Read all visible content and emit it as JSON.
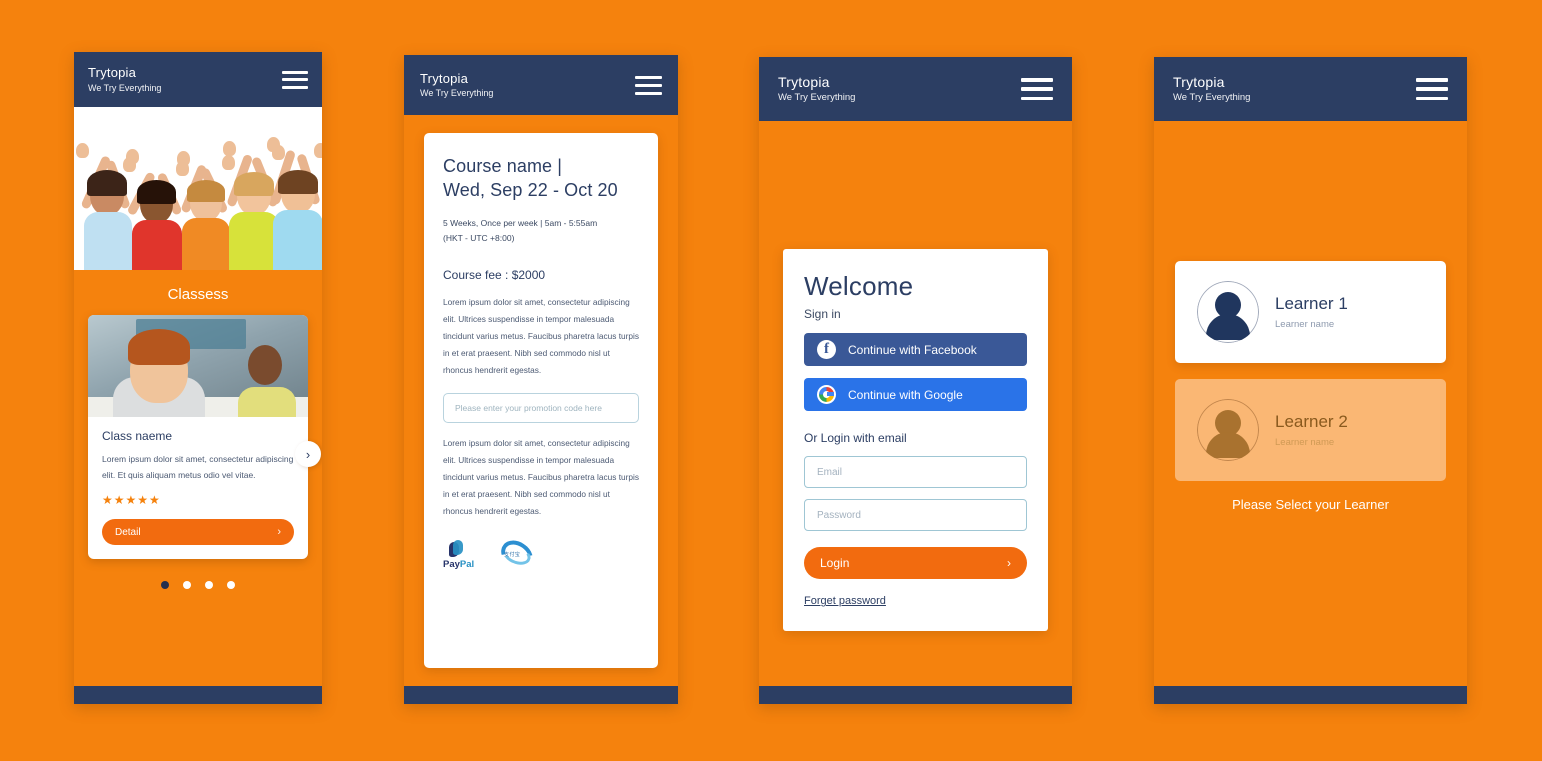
{
  "brand": {
    "name": "Trytopia",
    "tagline": "We Try Everything",
    "menu_icon": "hamburger-icon"
  },
  "colors": {
    "orange": "#F5820D",
    "orange_button": "#F26B0F",
    "navy": "#2C3E63",
    "facebook_blue": "#3A5897",
    "google_blue": "#2A73E8",
    "card_orange": "#FAB774"
  },
  "screen1": {
    "section_title": "Classess",
    "card": {
      "title": "Class naeme",
      "description": "Lorem ipsum dolor sit amet, consectetur adipiscing elit. Et quis aliquam metus odio vel vitae.",
      "stars": "★★★★★",
      "rating": 5,
      "detail_label": "Detail",
      "chevron": "›"
    },
    "carousel_next": "›",
    "dots": [
      {
        "active": true
      },
      {
        "active": false
      },
      {
        "active": false
      },
      {
        "active": false
      }
    ]
  },
  "screen2": {
    "title": "Course name |\nWed, Sep 22 - Oct 20",
    "title_line1": "Course name |",
    "title_line2": "Wed, Sep 22 - Oct 20",
    "meta_line1": "5 Weeks, Once per week  |  5am - 5:55am",
    "meta_line2": "(HKT - UTC +8:00)",
    "fee": "Course fee : $2000",
    "body_top": "Lorem ipsum dolor sit amet, consectetur adipiscing elit. Ultrices suspendisse in tempor malesuada tincidunt varius metus. Faucibus pharetra lacus turpis in et erat praesent. Nibh sed commodo nisl ut rhoncus hendrerit egestas.",
    "promo_placeholder": "Please enter your promotion code here",
    "promo_value": "",
    "body_bottom": "Lorem ipsum dolor sit amet, consectetur adipiscing elit. Ultrices suspendisse in tempor malesuada tincidunt varius metus. Faucibus pharetra lacus turpis in et erat praesent. Nibh sed commodo nisl ut rhoncus hendrerit egestas.",
    "paypal_a": "Pay",
    "paypal_b": "Pal",
    "alipay_text": "支付宝"
  },
  "screen3": {
    "welcome": "Welcome",
    "signin": "Sign in",
    "facebook_label": "Continue with Facebook",
    "google_label": "Continue with Google",
    "or_login": "Or Login with email",
    "email_placeholder": "Email",
    "email_value": "",
    "password_placeholder": "Password",
    "password_value": "",
    "login_label": "Login",
    "login_chevron": "›",
    "forget_label": "Forget password"
  },
  "screen4": {
    "learners": [
      {
        "name": "Learner 1",
        "sub": "Learner name",
        "selected": false
      },
      {
        "name": "Learner 2",
        "sub": "Learner name",
        "selected": true
      }
    ],
    "note": "Please Select your Learner"
  }
}
